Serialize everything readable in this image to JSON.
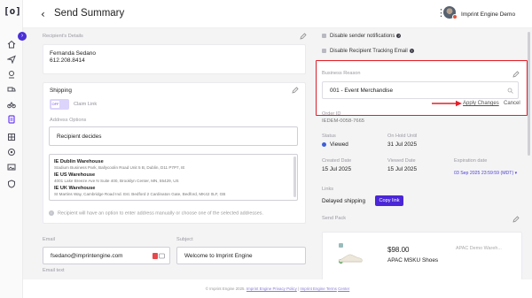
{
  "header": {
    "title": "Send Summary",
    "account_name": "Imprint Engine Demo"
  },
  "recipient": {
    "section_label": "Recipient's Details",
    "name": "Fernanda Sedano",
    "phone": "612.208.8414"
  },
  "shipping": {
    "section_label": "Shipping",
    "toggle_state": "off",
    "toggle_text": "OFF",
    "claim_link_label": "Claim Link",
    "address_options_label": "Address Options",
    "address_options_value": "Recipient decides",
    "warehouses": [
      {
        "name": "IE Dublin Warehouse",
        "address": "Stadium Business Park, Ballycoolin Road Unit 5 B, Dublin, D11 P7P7, IE"
      },
      {
        "name": "IE US Warehouse",
        "address": "4001 Lake Breeze Ave N  Suite 400, Brooklyn Center, MN, 55429, US"
      },
      {
        "name": "IE UK Warehouse",
        "address": "St Martins Way, Cambridge Road Ind. Est. Bedford 2 Cardinaton Gate, Bedford, MK42 0LF, GB"
      }
    ],
    "note": "Recipient will have an option to enter address manually or choose one of the selected addresses."
  },
  "email": {
    "email_label": "Email",
    "email_value": "fsedano@imprintengine.com",
    "subject_label": "Subject",
    "subject_value": "Welcome to Imprint Engine",
    "email_text_label": "Email text"
  },
  "settings": {
    "disable_notifications": "Disable sender notifications",
    "disable_tracking": "Disable Recipient Tracking Email"
  },
  "business_reason": {
    "label": "Business Reason",
    "value": "001 - Event Merchandise",
    "apply_label": "Apply Changes",
    "cancel_label": "Cancel"
  },
  "order": {
    "order_id_label": "Order ID",
    "order_id": "IEDEM-0058-7665",
    "status_label": "Status",
    "status_value": "Viewed",
    "on_hold_label": "On Hold Until",
    "on_hold_value": "31 Jul 2025",
    "created_label": "Created Date",
    "created_value": "15 Jul 2025",
    "viewed_label": "Viewed Date",
    "viewed_value": "15 Jul 2025",
    "expiration_label": "Expiration date",
    "expiration_value": "03 Sep 2025 23:59:59 (MDT)"
  },
  "links": {
    "label": "Links",
    "delayed_shipping": "Delayed shipping",
    "copy_link_label": "Copy link"
  },
  "send_pack": {
    "label": "Send Pack",
    "price": "$98.00",
    "product_name": "APAC MSKU Shoes",
    "warehouse": "APAC Demo Wareh..."
  },
  "footer": {
    "copyright": "© Imprint Engine 2025.",
    "privacy": "Imprint Engine Privacy Policy",
    "terms": "Imprint Engine Terms",
    "center": "Center"
  },
  "colors": {
    "accent": "#4a26d8",
    "highlight": "#e4202a",
    "status": "#3e5fd9"
  }
}
